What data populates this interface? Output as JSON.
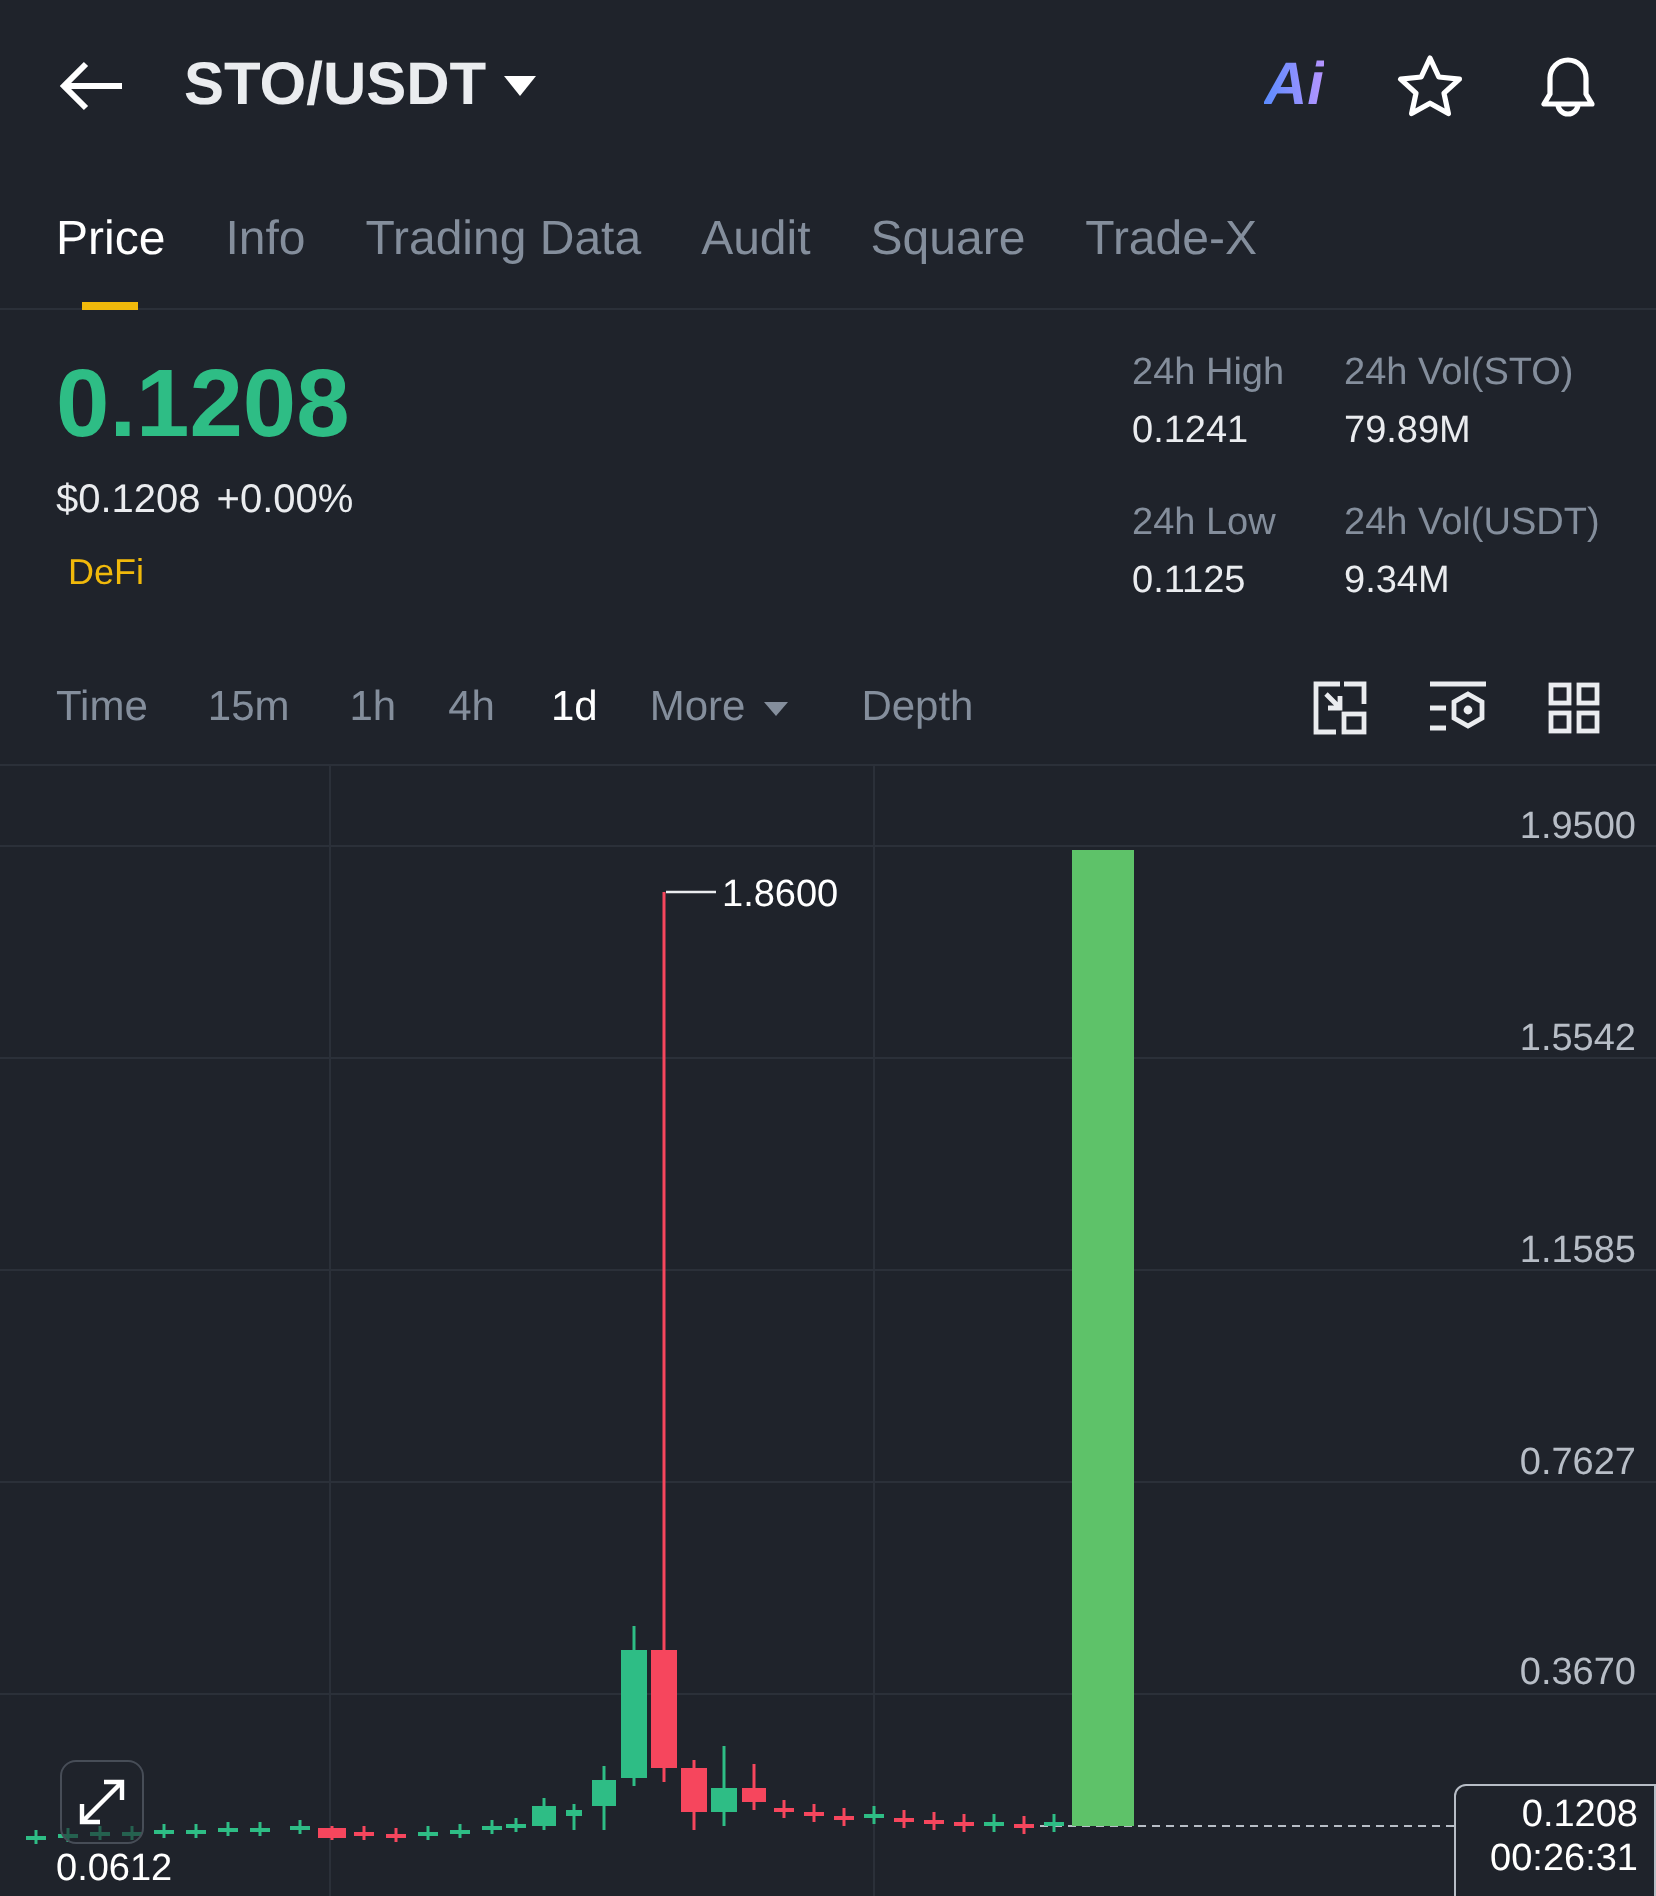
{
  "header": {
    "pair": "STO/USDT",
    "ai_badge": "Ai"
  },
  "tabs": [
    {
      "label": "Price",
      "selected": true
    },
    {
      "label": "Info",
      "selected": false
    },
    {
      "label": "Trading Data",
      "selected": false
    },
    {
      "label": "Audit",
      "selected": false
    },
    {
      "label": "Square",
      "selected": false
    },
    {
      "label": "Trade-X",
      "selected": false
    }
  ],
  "price": {
    "last": "0.1208",
    "usd": "$0.1208",
    "change": "+0.00%",
    "tag": "DeFi"
  },
  "stats": [
    {
      "label": "24h High",
      "value": "0.1241"
    },
    {
      "label": "24h Vol(STO)",
      "value": "79.89M"
    },
    {
      "label": "24h Low",
      "value": "0.1125"
    },
    {
      "label": "24h Vol(USDT)",
      "value": "9.34M"
    }
  ],
  "intervals": [
    {
      "label": "Time",
      "selected": false,
      "kind": "plain"
    },
    {
      "label": "15m",
      "selected": false,
      "kind": "plain"
    },
    {
      "label": "1h",
      "selected": false,
      "kind": "plain"
    },
    {
      "label": "4h",
      "selected": false,
      "kind": "plain"
    },
    {
      "label": "1d",
      "selected": true,
      "kind": "plain"
    },
    {
      "label": "More",
      "selected": false,
      "kind": "dropdown"
    },
    {
      "label": "Depth",
      "selected": false,
      "kind": "plain"
    }
  ],
  "chart": {
    "y_labels": [
      "1.9500",
      "1.5542",
      "1.1585",
      "0.7627",
      "0.3670"
    ],
    "high_label": "1.8600",
    "low_label": "0.0612",
    "price_tag": "0.1208",
    "countdown": "00:26:31"
  }
}
